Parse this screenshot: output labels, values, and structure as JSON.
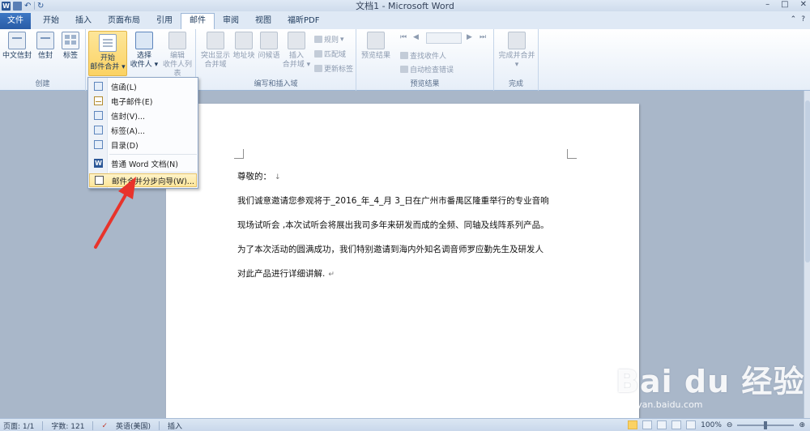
{
  "window": {
    "title": "文档1 - Microsoft Word"
  },
  "tabs": {
    "file": "文件",
    "items": [
      "开始",
      "插入",
      "页面布局",
      "引用",
      "邮件",
      "审阅",
      "视图",
      "福昕PDF"
    ],
    "active_index": 4
  },
  "ribbon": {
    "create": {
      "label": "创建",
      "chinese_envelope": "中文信封",
      "envelope": "信封",
      "labels": "标签"
    },
    "start_merge": {
      "start_line1": "开始",
      "start_line2": "邮件合并",
      "select_line1": "选择",
      "select_line2": "收件人",
      "edit_line1": "编辑",
      "edit_line2": "收件人列表"
    },
    "write_insert": {
      "label": "编写和插入域",
      "highlight_line1": "突出显示",
      "highlight_line2": "合并域",
      "address_block": "地址块",
      "greeting_line": "问候语",
      "insert_line1": "插入",
      "insert_line2": "合并域",
      "rules": "规则",
      "match_fields": "匹配域",
      "update_labels": "更新标签"
    },
    "preview": {
      "label": "预览结果",
      "preview_results": "预览结果",
      "find_recipient": "查找收件人",
      "auto_check": "自动检查错误"
    },
    "finish": {
      "label": "完成",
      "finish_merge": "完成并合并"
    }
  },
  "menu": {
    "items": [
      {
        "label": "信函(L)",
        "icon": "letter-icon"
      },
      {
        "label": "电子邮件(E)",
        "icon": "email-icon"
      },
      {
        "label": "信封(V)...",
        "icon": "envelope-icon"
      },
      {
        "label": "标签(A)...",
        "icon": "label-icon"
      },
      {
        "label": "目录(D)",
        "icon": "directory-icon"
      },
      {
        "label": "普通 Word 文档(N)",
        "icon": "word-icon"
      },
      {
        "label": "邮件合并分步向导(W)...",
        "icon": "wizard-icon"
      }
    ]
  },
  "document": {
    "salutation": "尊敬的：",
    "line1": "我们诚意邀请您参观将于_2016_年_4_月 3_日在广州市番禺区隆重举行的专业音响",
    "line2": "现场试听会 ,本次试听会将展出我司多年来研发而成的全频、同轴及线阵系列产品。",
    "line3": "为了本次活动的圆满成功，我们特别邀请到海内外知名调音师罗应勤先生及研发人",
    "line4": "对此产品进行详细讲解."
  },
  "statusbar": {
    "page": "页面: 1/1",
    "words": "字数: 121",
    "language": "英语(美国)",
    "mode": "插入",
    "zoom": "100%"
  },
  "watermark": {
    "brand": "Bai du 经验",
    "url": "jingyan.baidu.com"
  },
  "colors": {
    "accent": "#2b5797",
    "highlight": "#fbd263",
    "arrow": "#e8332b"
  }
}
